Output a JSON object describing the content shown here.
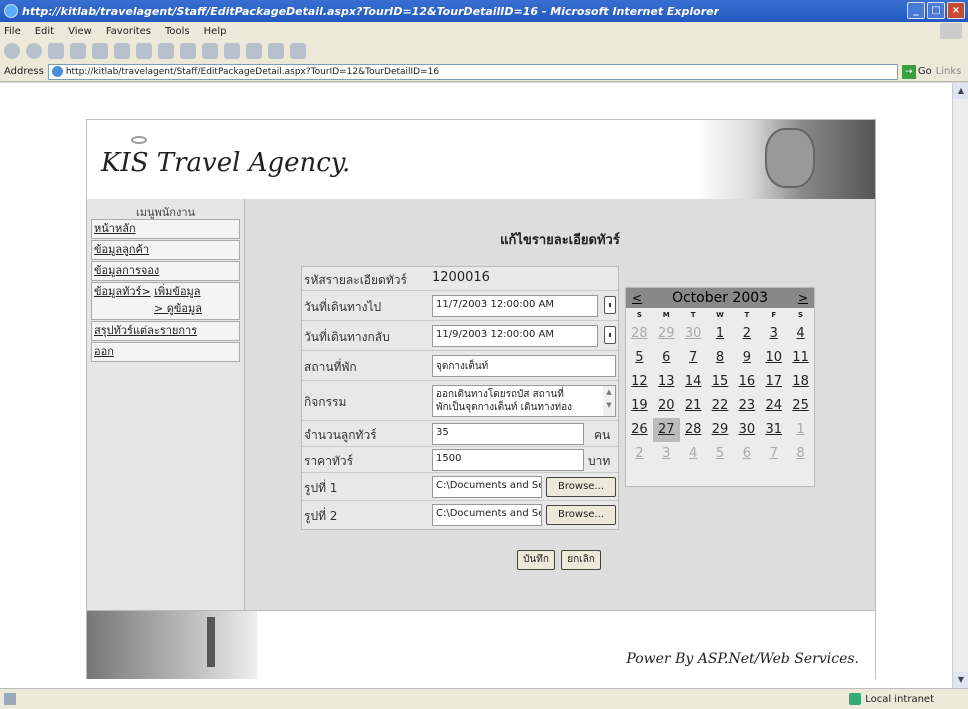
{
  "window": {
    "title": "http://kitlab/travelagent/Staff/EditPackageDetail.aspx?TourID=12&TourDetailID=16 - Microsoft Internet Explorer"
  },
  "menu": [
    "File",
    "Edit",
    "View",
    "Favorites",
    "Tools",
    "Help"
  ],
  "address": {
    "label": "Address",
    "url": "http://kitlab/travelagent/Staff/EditPackageDetail.aspx?TourID=12&TourDetailID=16",
    "go": "Go",
    "links": "Links"
  },
  "status": {
    "zone": "Local intranet"
  },
  "page": {
    "logo": "KIS Travel Agency.",
    "footer": "Power By ASP.Net/Web Services."
  },
  "sidebar": {
    "title": "เมนูพนักงาน",
    "items": [
      "หน้าหลัก",
      "ข้อมูลลูกค้า",
      "ข้อมูลการจอง",
      "ข้อมูลทัวร์>",
      "เพิ่มข้อมูล",
      "> ดูข้อมูล",
      "สรุปทัวร์แต่ละรายการ",
      "ออก"
    ]
  },
  "form": {
    "title": "แก้ไขรายละเอียดทัวร์",
    "detail_id_label": "รหัสรายละเอียดทัวร์",
    "detail_id": "1200016",
    "depart_label": "วันที่เดินทางไป",
    "depart_value": "11/7/2003 12:00:00 AM",
    "return_label": "วันที่เดินทางกลับ",
    "return_value": "11/9/2003 12:00:00 AM",
    "lodging_label": "สถานที่พัก",
    "lodging_value": "จุดกางเต็นท์",
    "activity_label": "กิจกรรม",
    "activity_line1": "ออกเดินทางโดยรถบัส สถานที่",
    "activity_line2": "พักเป็นจุดกางเต็นท์ เดินทางท่อง",
    "count_label": "จำนวนลูกทัวร์",
    "count_value": "35",
    "count_unit": "คน",
    "price_label": "ราคาทัวร์",
    "price_value": "1500",
    "price_unit": "บาท",
    "photo1_label": "รูปที่ 1",
    "photo1_value": "C:\\Documents and Settings",
    "photo2_label": "รูปที่ 2",
    "photo2_value": "C:\\Documents and Settings",
    "browse": "Browse...",
    "save": "บันทึก",
    "cancel": "ยกเลิก"
  },
  "calendar": {
    "month": "October 2003",
    "prev": "<",
    "next": ">",
    "dow": [
      "S",
      "M",
      "T",
      "W",
      "T",
      "F",
      "S"
    ],
    "days": [
      {
        "d": "28",
        "other": true
      },
      {
        "d": "29",
        "other": true
      },
      {
        "d": "30",
        "other": true
      },
      {
        "d": "1"
      },
      {
        "d": "2"
      },
      {
        "d": "3"
      },
      {
        "d": "4"
      },
      {
        "d": "5"
      },
      {
        "d": "6"
      },
      {
        "d": "7"
      },
      {
        "d": "8"
      },
      {
        "d": "9"
      },
      {
        "d": "10"
      },
      {
        "d": "11"
      },
      {
        "d": "12"
      },
      {
        "d": "13"
      },
      {
        "d": "14"
      },
      {
        "d": "15"
      },
      {
        "d": "16"
      },
      {
        "d": "17"
      },
      {
        "d": "18"
      },
      {
        "d": "19"
      },
      {
        "d": "20"
      },
      {
        "d": "21"
      },
      {
        "d": "22"
      },
      {
        "d": "23"
      },
      {
        "d": "24"
      },
      {
        "d": "25"
      },
      {
        "d": "26"
      },
      {
        "d": "27",
        "selected": true
      },
      {
        "d": "28"
      },
      {
        "d": "29"
      },
      {
        "d": "30"
      },
      {
        "d": "31"
      },
      {
        "d": "1",
        "other": true
      },
      {
        "d": "2",
        "other": true
      },
      {
        "d": "3",
        "other": true
      },
      {
        "d": "4",
        "other": true
      },
      {
        "d": "5",
        "other": true
      },
      {
        "d": "6",
        "other": true
      },
      {
        "d": "7",
        "other": true
      },
      {
        "d": "8",
        "other": true
      }
    ]
  }
}
